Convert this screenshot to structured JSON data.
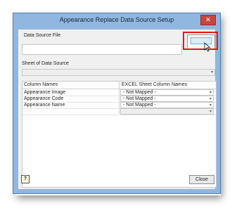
{
  "window": {
    "title": "Appearance Replace Data Source Setup",
    "close_glyph": "✕"
  },
  "data_source_file": {
    "label": "Data Source File",
    "value": ""
  },
  "browse_button": {
    "label": ""
  },
  "sheet": {
    "label": "Sheet of Data Source",
    "value": ""
  },
  "grid": {
    "headers": [
      "Column Names",
      "EXCEL Sheet Column Names"
    ],
    "rows": [
      {
        "name": "Appearance Image",
        "mapping": "- Not Mapped -"
      },
      {
        "name": "Appearance Code",
        "mapping": "- Not Mapped -"
      },
      {
        "name": "Appearance Name",
        "mapping": "- Not Mapped -"
      },
      {
        "name": "",
        "mapping": ""
      }
    ]
  },
  "footer": {
    "help_glyph": "?",
    "close_label": "Close"
  },
  "icons": [
    "close-icon",
    "dropdown-arrow-icon",
    "help-icon",
    "mouse-cursor-icon"
  ],
  "colors": {
    "highlight": "#e01818",
    "title_bar": "#8fb7e0",
    "close_button": "#c9463d"
  }
}
